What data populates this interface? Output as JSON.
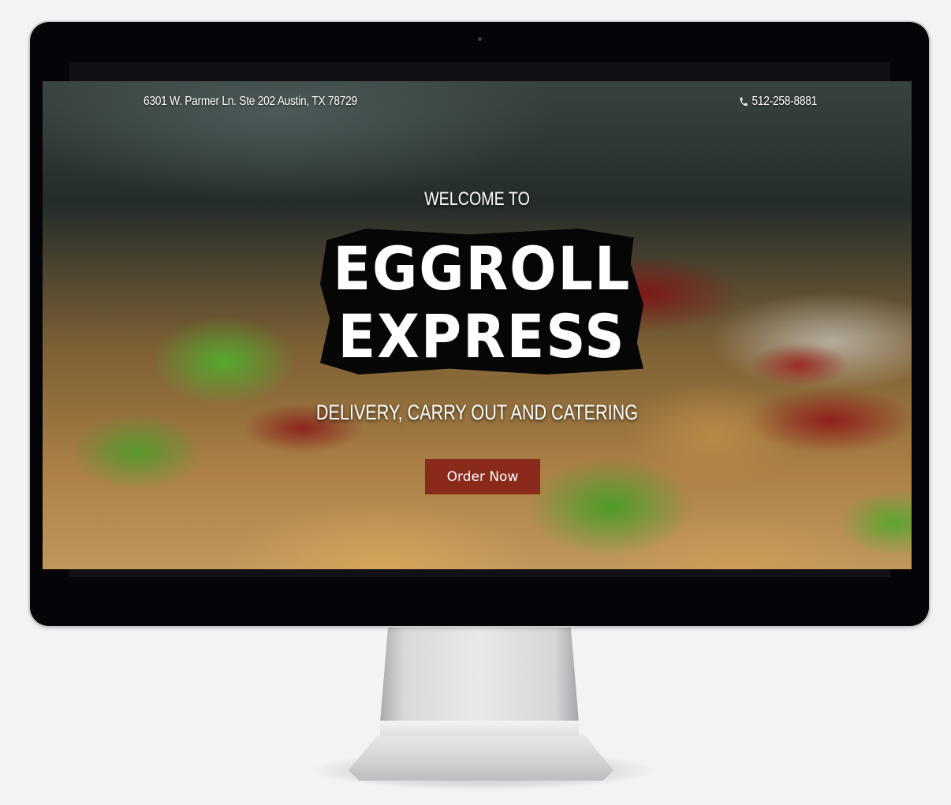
{
  "topbar": {
    "address": "6301 W. Parmer Ln. Ste 202 Austin, TX 78729",
    "phone": "512-258-8881",
    "phone_icon": "phone-icon"
  },
  "hero": {
    "welcome": "WELCOME TO",
    "logo_line1": "EGGROLL",
    "logo_line2": "EXPRESS",
    "tagline": "DELIVERY, CARRY OUT AND CATERING",
    "cta_label": "Order Now"
  },
  "colors": {
    "cta_background": "#8a2a1b",
    "logo_background": "#060606",
    "monitor_bezel": "#050509"
  }
}
